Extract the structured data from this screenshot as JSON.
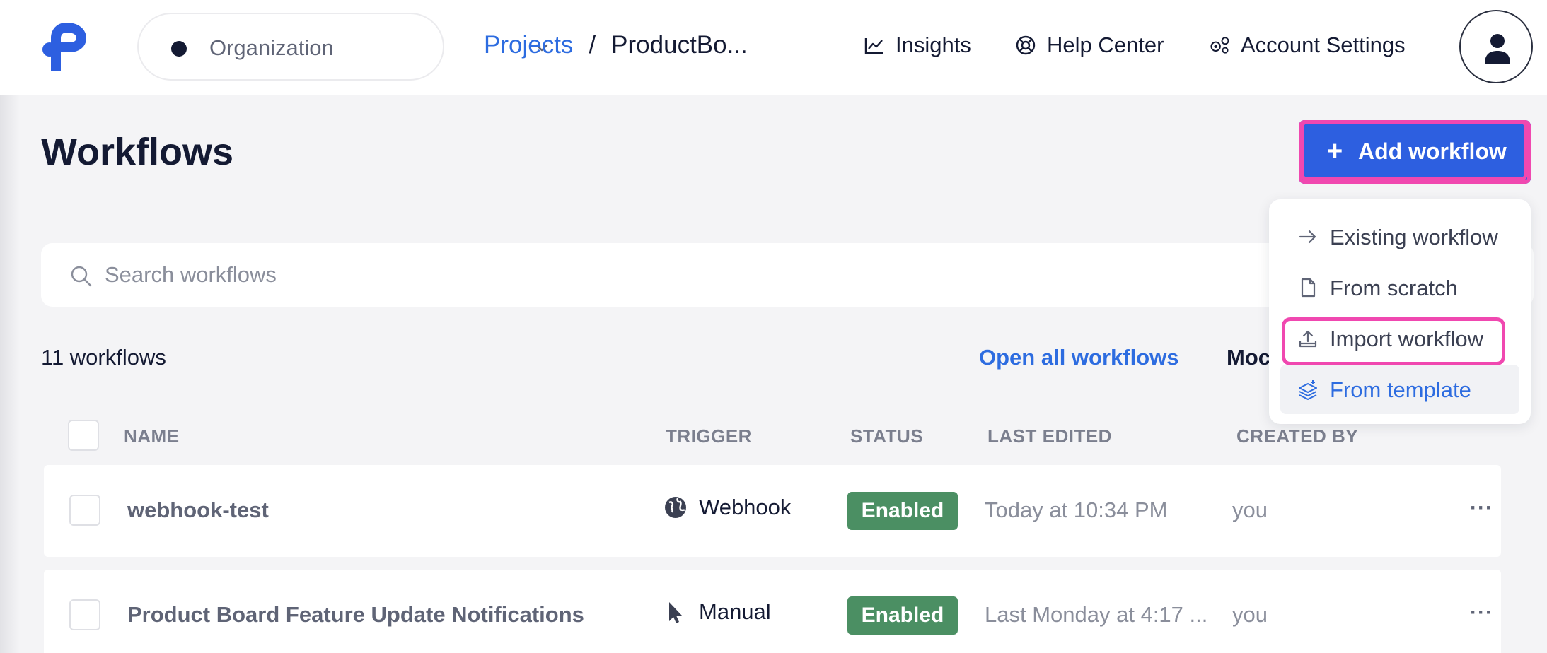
{
  "header": {
    "org": {
      "label": "Organization"
    },
    "breadcrumb": {
      "projects": "Projects",
      "separator": "/",
      "current": "ProductBo..."
    },
    "nav": {
      "insights": "Insights",
      "help": "Help Center",
      "settings": "Account Settings"
    }
  },
  "page": {
    "title": "Workflows",
    "add_button": "Add workflow",
    "add_plus": "+"
  },
  "search": {
    "placeholder": "Search workflows",
    "value": ""
  },
  "toolbar": {
    "count": "11 workflows",
    "open_all": "Open all workflows",
    "mode_truncated": "Moc"
  },
  "table": {
    "headers": {
      "name": "NAME",
      "trigger": "TRIGGER",
      "status": "STATUS",
      "last_edited": "LAST EDITED",
      "created_by": "CREATED BY"
    },
    "rows": [
      {
        "name": "webhook-test",
        "trigger": "Webhook",
        "trigger_icon": "globe-icon",
        "status": "Enabled",
        "last_edited": "Today at 10:34 PM",
        "created_by": "you",
        "actions": "···"
      },
      {
        "name": "Product Board Feature Update Notifications",
        "trigger": "Manual",
        "trigger_icon": "cursor-icon",
        "status": "Enabled",
        "last_edited": "Last Monday at 4:17 ...",
        "created_by": "you",
        "actions": "···"
      }
    ]
  },
  "menu": {
    "items": [
      {
        "label": "Existing workflow",
        "icon": "arrow-right-icon"
      },
      {
        "label": "From scratch",
        "icon": "file-icon"
      },
      {
        "label": "Import workflow",
        "icon": "upload-icon"
      },
      {
        "label": "From template",
        "icon": "template-icon"
      }
    ]
  },
  "colors": {
    "accent": "#2d5fe0",
    "link": "#2d6ce0",
    "enabled": "#4b8f63",
    "highlight": "#f048b0",
    "text": "#141a33"
  }
}
